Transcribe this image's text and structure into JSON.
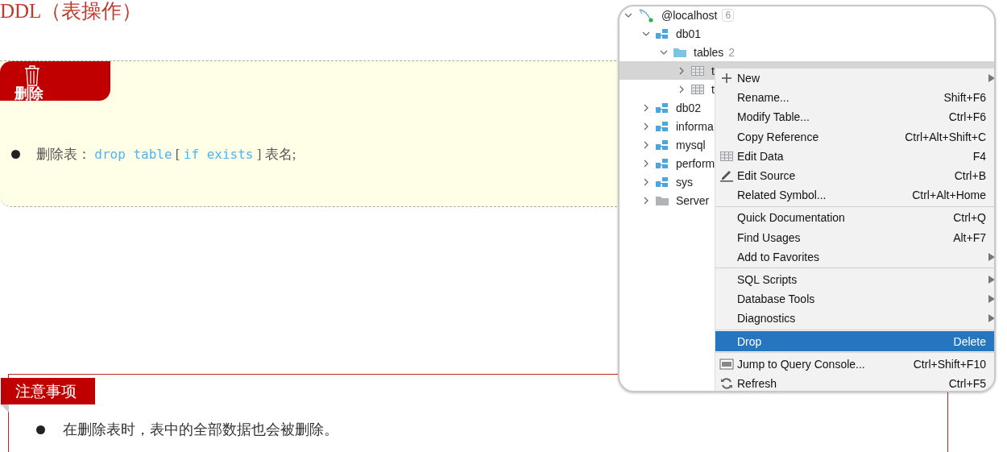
{
  "title": "DDL（表操作）",
  "delete_card": {
    "tab_label": "删除",
    "bullets": [
      {
        "segments": [
          {
            "kind": "text",
            "text": "删除表："
          },
          {
            "kind": "code",
            "text": "drop table"
          },
          {
            "kind": "text",
            "text": "["
          },
          {
            "kind": "code",
            "text": "if exists"
          },
          {
            "kind": "text",
            "text": "]"
          },
          {
            "kind": "text",
            "text": "表名;"
          }
        ]
      }
    ]
  },
  "notes_card": {
    "label": "注意事项",
    "bullets": [
      "在删除表时，表中的全部数据也会被删除。"
    ]
  },
  "tree": [
    {
      "kind": "host",
      "label": "@localhost",
      "badge": "6",
      "expanded": true,
      "selected": false,
      "children": [
        {
          "kind": "schema",
          "label": "db01",
          "expanded": true,
          "selected": false,
          "children": [
            {
              "kind": "folder",
              "label": "tables",
              "count": "2",
              "expanded": true,
              "selected": false,
              "children": [
                {
                  "kind": "table",
                  "label": "t",
                  "expanded": false,
                  "selected": true
                },
                {
                  "kind": "table",
                  "label": "t",
                  "expanded": false,
                  "selected": false
                }
              ]
            }
          ]
        },
        {
          "kind": "schema",
          "label": "db02",
          "expanded": false,
          "selected": false
        },
        {
          "kind": "schema",
          "label": "informa",
          "expanded": false,
          "selected": false
        },
        {
          "kind": "schema",
          "label": "mysql",
          "expanded": false,
          "selected": false
        },
        {
          "kind": "schema",
          "label": "perform",
          "expanded": false,
          "selected": false
        },
        {
          "kind": "schema",
          "label": "sys",
          "expanded": false,
          "selected": false
        },
        {
          "kind": "server",
          "label": "Server",
          "expanded": false,
          "selected": false
        }
      ]
    }
  ],
  "context_menu": [
    {
      "kind": "item",
      "label": "New",
      "submenu": true,
      "selected": false
    },
    {
      "kind": "item",
      "label": "Rename...",
      "shortcut": "Shift+F6",
      "selected": false
    },
    {
      "kind": "item",
      "label": "Modify Table...",
      "shortcut": "Ctrl+F6",
      "selected": false
    },
    {
      "kind": "item",
      "label": "Copy Reference",
      "shortcut": "Ctrl+Alt+Shift+C",
      "selected": false
    },
    {
      "kind": "item",
      "label": "Edit Data",
      "shortcut": "F4",
      "selected": false
    },
    {
      "kind": "item",
      "label": "Edit Source",
      "shortcut": "Ctrl+B",
      "selected": false
    },
    {
      "kind": "item",
      "label": "Related Symbol...",
      "shortcut": "Ctrl+Alt+Home",
      "selected": false
    },
    {
      "kind": "separator"
    },
    {
      "kind": "item",
      "label": "Quick Documentation",
      "shortcut": "Ctrl+Q",
      "selected": false
    },
    {
      "kind": "item",
      "label": "Find Usages",
      "shortcut": "Alt+F7",
      "selected": false
    },
    {
      "kind": "item",
      "label": "Add to Favorites",
      "submenu": true,
      "selected": false
    },
    {
      "kind": "separator"
    },
    {
      "kind": "item",
      "label": "SQL Scripts",
      "submenu": true,
      "selected": false
    },
    {
      "kind": "item",
      "label": "Database Tools",
      "submenu": true,
      "selected": false
    },
    {
      "kind": "item",
      "label": "Diagnostics",
      "submenu": true,
      "selected": false
    },
    {
      "kind": "separator"
    },
    {
      "kind": "item",
      "label": "Drop",
      "shortcut": "Delete",
      "selected": true
    },
    {
      "kind": "separator"
    },
    {
      "kind": "item",
      "label": "Jump to Query Console...",
      "shortcut": "Ctrl+Shift+F10",
      "selected": false
    },
    {
      "kind": "item",
      "label": "Refresh",
      "shortcut": "Ctrl+F5",
      "selected": false
    }
  ]
}
